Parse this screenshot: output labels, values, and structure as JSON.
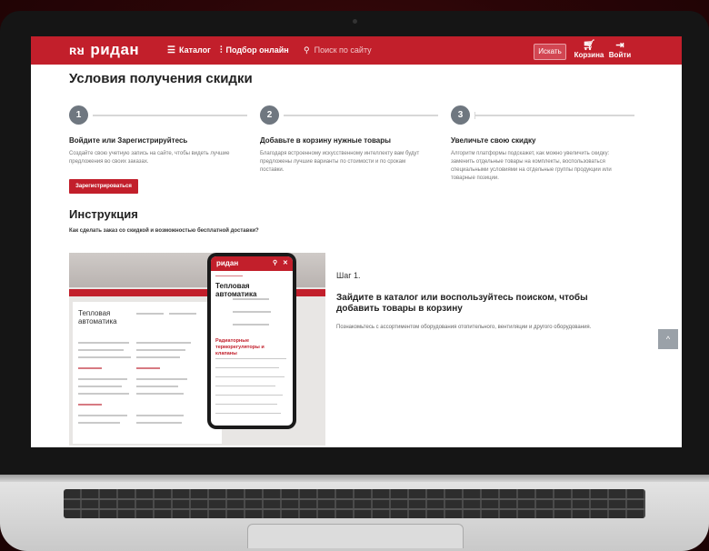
{
  "header": {
    "logo": "ридан",
    "catalog": "Каталог",
    "online_select": "Подбор онлайн",
    "search_placeholder": "Поиск по сайту",
    "find_button": "Искать",
    "cart": "Корзина",
    "login": "Войти"
  },
  "page_title": "Условия получения скидки",
  "steps": [
    {
      "num": "1",
      "title": "Войдите или Зарегистрируйтесь",
      "text": "Создайте свою учетную запись на сайте, чтобы видеть лучшие предложения во своих заказах."
    },
    {
      "num": "2",
      "title": "Добавьте в корзину нужные товары",
      "text": "Благодаря встроенному искусственному интеллекту вам будут предложены лучшие варианты по стоимости и по срокам поставки."
    },
    {
      "num": "3",
      "title": "Увеличьте свою скидку",
      "text": "Алгоритм платформы подскажет, как можно увеличить скидку: заменить отдельные товары на комплекты, воспользоваться специальными условиями на отдельные группы продукции или товарные позиции."
    }
  ],
  "register_button": "Зарегистрироваться",
  "instruction": {
    "title": "Инструкция",
    "question": "Как сделать заказ со скидкой и возможностью бесплатной доставки?"
  },
  "preview": {
    "desktop_title": "Тепловая автоматика",
    "phone_logo": "ридан",
    "phone_title": "Тепловая автоматика",
    "phone_section": "Радиаторные терморегуляторы и клапаны"
  },
  "step_detail": {
    "label": "Шаг 1.",
    "heading": "Зайдите в каталог или воспользуйтесь поиском, чтобы добавить товары в корзину",
    "text": "Познакомьтесь с ассортиментом оборудования отопительного, вентиляции и другого оборудования."
  },
  "colors": {
    "brand": "#c21f2b",
    "step_circle": "#6f7780"
  },
  "icons": {
    "up": "chevron-up-icon",
    "cart": "cart-icon",
    "login": "login-icon",
    "search": "search-icon"
  }
}
